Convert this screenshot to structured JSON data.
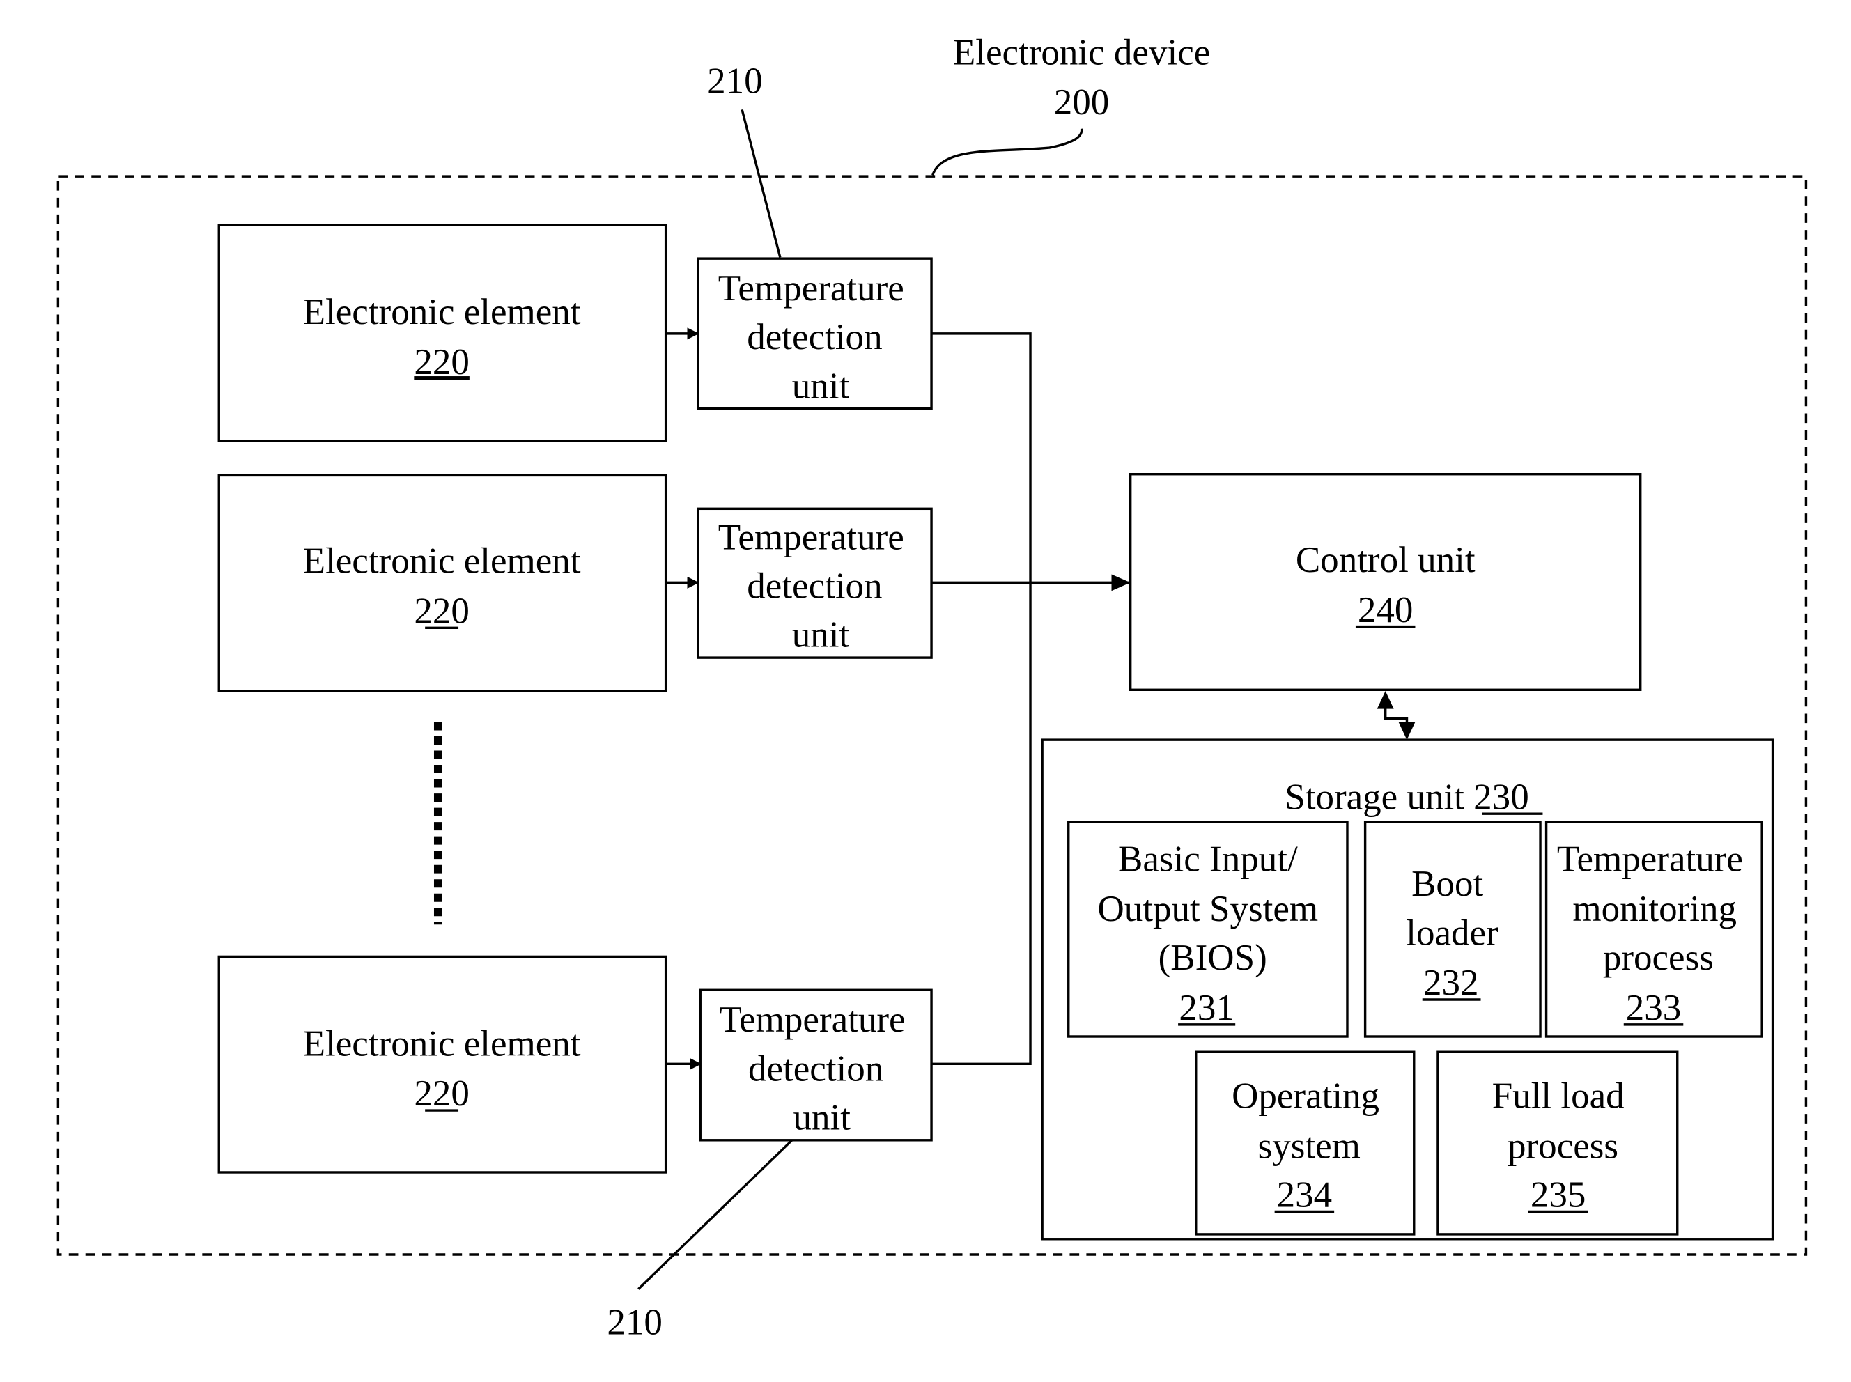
{
  "device": {
    "label": "Electronic device",
    "ref": "200"
  },
  "ref_210_top": "210",
  "ref_210_bottom": "210",
  "elements": [
    {
      "label": "Electronic element",
      "ref": "220"
    },
    {
      "label": "Electronic element",
      "ref": "220"
    },
    {
      "label": "Electronic element",
      "ref": "220"
    }
  ],
  "detectors": [
    {
      "lines": [
        "Temperature",
        "detection",
        "unit"
      ]
    },
    {
      "lines": [
        "Temperature",
        "detection",
        "unit"
      ]
    },
    {
      "lines": [
        "Temperature",
        "detection",
        "unit"
      ]
    }
  ],
  "control": {
    "label": "Control unit",
    "ref": "240"
  },
  "storage": {
    "label": "Storage unit ",
    "ref": "230",
    "items": [
      {
        "lines": [
          "Basic Input/",
          "Output System",
          "(BIOS)"
        ],
        "ref": "231"
      },
      {
        "lines": [
          "Boot",
          "loader"
        ],
        "ref": "232"
      },
      {
        "lines": [
          "Temperature",
          "monitoring",
          "process"
        ],
        "ref": "233"
      },
      {
        "lines": [
          "Operating",
          "system"
        ],
        "ref": "234"
      },
      {
        "lines": [
          "Full load",
          "process"
        ],
        "ref": "235"
      }
    ]
  }
}
